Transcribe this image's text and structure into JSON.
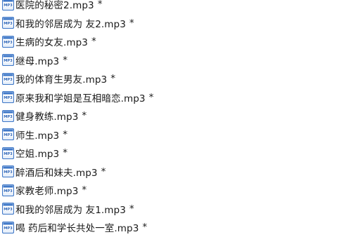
{
  "file_list": {
    "modified_marker": "*",
    "icon": "mp3-file-icon",
    "icon_colors": {
      "frame": "#3f78c8",
      "fill": "#ffffff",
      "band": "#e9f1fb",
      "badge_text": "#2f66b8"
    },
    "icon_badge_text": "MP3",
    "files": [
      "医院的秘密2.mp3",
      "和我的邻居成为    友2.mp3",
      "生病的女友.mp3",
      "继母.mp3",
      "我的体育生男友.mp3",
      "原来我和学姐是互相暗恋.mp3",
      "健身教练.mp3",
      "师生.mp3",
      "空姐.mp3",
      "醉酒后和妹夫.mp3",
      "家教老师.mp3",
      "和我的邻居成为    友1.mp3",
      "喝    药后和学长共处一室.mp3"
    ]
  }
}
